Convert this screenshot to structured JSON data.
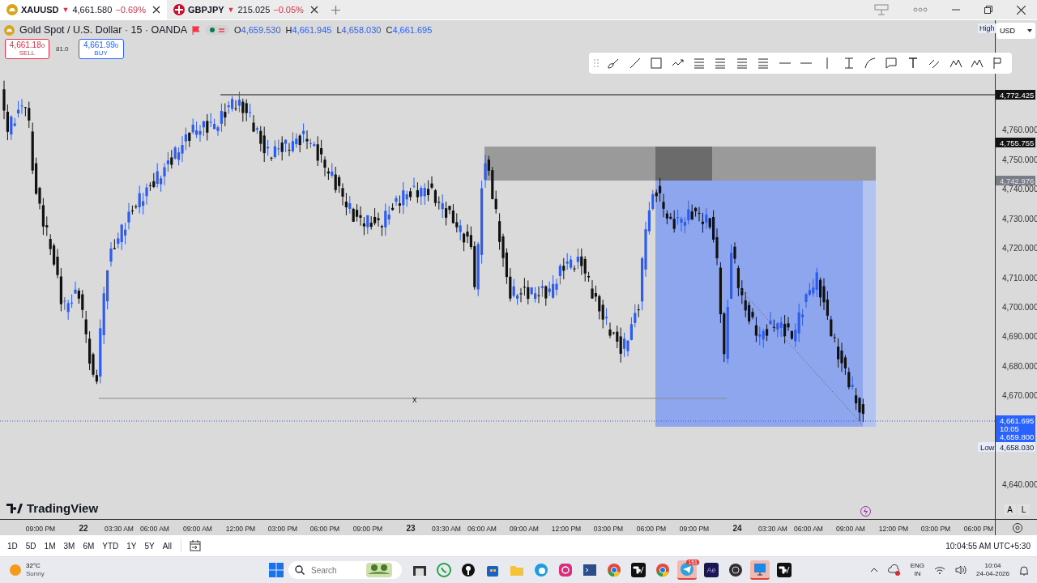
{
  "tabs": [
    {
      "symbol": "XAUUSD",
      "arrow": "▼",
      "price": "4,661.580",
      "change": "−0.69%",
      "selected": true
    },
    {
      "symbol": "GBPJPY",
      "arrow": "▼",
      "price": "215.025",
      "change": "−0.05%",
      "selected": false
    }
  ],
  "header": {
    "title": "Gold Spot / U.S. Dollar · 15 · OANDA",
    "ohlc": [
      {
        "label": "O",
        "value": "4,659.530"
      },
      {
        "label": "H",
        "value": "4,661.945"
      },
      {
        "label": "L",
        "value": "4,658.030"
      },
      {
        "label": "C",
        "value": "4,661.695"
      }
    ]
  },
  "trade": {
    "sell": {
      "price": "4,661.18",
      "pip": "0",
      "label": "SELL"
    },
    "spread": "81.0",
    "buy": {
      "price": "4,661.99",
      "pip": "0",
      "label": "BUY"
    }
  },
  "currency": "USD",
  "brand": "TradingView",
  "marker": "x",
  "price_axis": {
    "ticks": [
      "4,760.000",
      "4,750.000",
      "4,740.000",
      "4,730.000",
      "4,720.000",
      "4,710.000",
      "4,700.000",
      "4,690.000",
      "4,680.000",
      "4,670.000",
      "4,640.000"
    ],
    "high_label": "High",
    "low_label": "Low",
    "tags": [
      {
        "kind": "line",
        "text": "4,772.425"
      },
      {
        "kind": "line",
        "text": "4,755.755"
      },
      {
        "kind": "zone",
        "text": "4,742.976"
      },
      {
        "kind": "low",
        "text": "4,658.030"
      }
    ],
    "last": {
      "price": "4,661.695",
      "countdown": "10:05",
      "bid": "4,659.800"
    },
    "buttons": [
      "A",
      "L"
    ]
  },
  "time_axis": [
    {
      "text": "09:00 PM",
      "bold": false
    },
    {
      "text": "22",
      "bold": true
    },
    {
      "text": "03:30 AM",
      "bold": false
    },
    {
      "text": "06:00 AM",
      "bold": false
    },
    {
      "text": "09:00 AM",
      "bold": false
    },
    {
      "text": "12:00 PM",
      "bold": false
    },
    {
      "text": "03:00 PM",
      "bold": false
    },
    {
      "text": "06:00 PM",
      "bold": false
    },
    {
      "text": "09:00 PM",
      "bold": false
    },
    {
      "text": "23",
      "bold": true
    },
    {
      "text": "03:30 AM",
      "bold": false
    },
    {
      "text": "06:00 AM",
      "bold": false
    },
    {
      "text": "09:00 AM",
      "bold": false
    },
    {
      "text": "12:00 PM",
      "bold": false
    },
    {
      "text": "03:00 PM",
      "bold": false
    },
    {
      "text": "06:00 PM",
      "bold": false
    },
    {
      "text": "09:00 PM",
      "bold": false
    },
    {
      "text": "24",
      "bold": true
    },
    {
      "text": "03:30 AM",
      "bold": false
    },
    {
      "text": "06:00 AM",
      "bold": false
    },
    {
      "text": "09:00 AM",
      "bold": false
    },
    {
      "text": "12:00 PM",
      "bold": false
    },
    {
      "text": "03:00 PM",
      "bold": false
    },
    {
      "text": "06:00 PM",
      "bold": false
    }
  ],
  "ranges": [
    "1D",
    "5D",
    "1M",
    "3M",
    "6M",
    "YTD",
    "1Y",
    "5Y",
    "All"
  ],
  "clock": "10:04:55 AM UTC+5:30",
  "taskbar": {
    "temperature": "32°C",
    "condition": "Sunny",
    "search_placeholder": "Search",
    "apps": [
      {
        "kind": "files",
        "active": false
      },
      {
        "kind": "chat",
        "active": false
      },
      {
        "kind": "pin",
        "active": false
      },
      {
        "kind": "store",
        "active": false
      },
      {
        "kind": "folder",
        "active": false
      },
      {
        "kind": "browser",
        "active": false
      },
      {
        "kind": "camera",
        "active": false
      },
      {
        "kind": "terminal",
        "active": false
      },
      {
        "kind": "chrome",
        "active": false
      },
      {
        "kind": "chart",
        "active": false
      },
      {
        "kind": "chrome",
        "active": false
      },
      {
        "kind": "telegram",
        "active": true,
        "badge": "151"
      },
      {
        "kind": "ae",
        "active": false,
        "label": "Ae"
      },
      {
        "kind": "obs",
        "active": false
      },
      {
        "kind": "monitor",
        "active": true
      },
      {
        "kind": "chart",
        "active": false
      }
    ],
    "language": "ENG",
    "region": "IN",
    "time": "10:04",
    "date": "24-04-2026"
  }
}
